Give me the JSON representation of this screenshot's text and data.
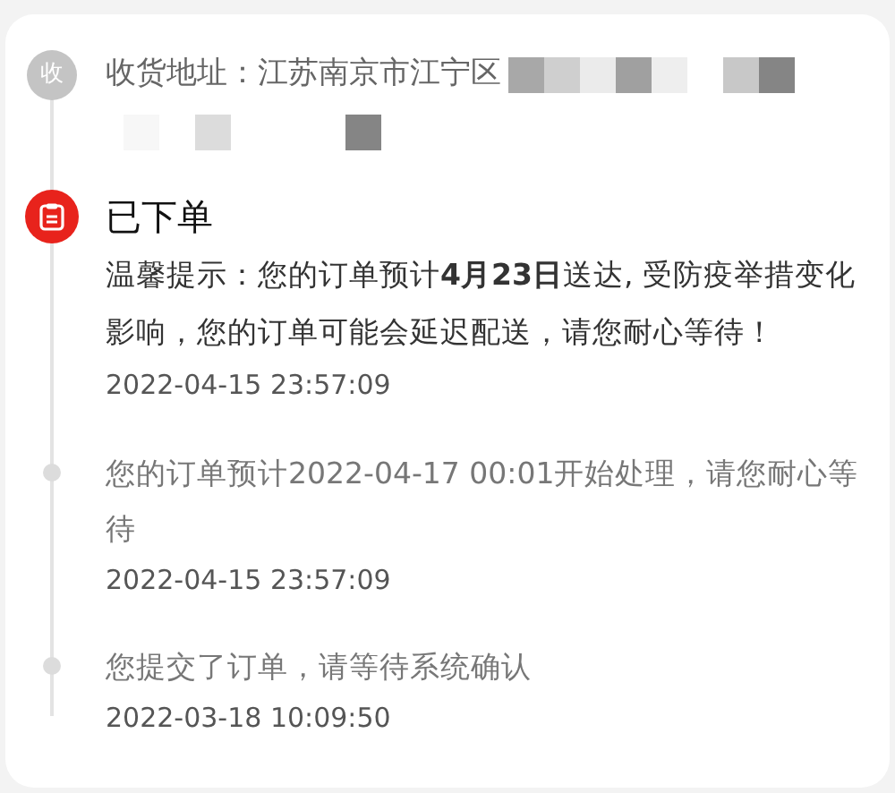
{
  "address": {
    "icon": "收",
    "text": "收货地址：江苏南京市江宁区"
  },
  "events": [
    {
      "kind": "milestone",
      "title": "已下单",
      "message": "温馨提示：您的订单预计**4月23日**送达, 受防疫举措变化影响，您的订单可能会延迟配送，请您耐心等待！",
      "time": "2022-04-15 23:57:09"
    },
    {
      "kind": "step",
      "message": "您的订单预计2022-04-17 00:01开始处理，请您耐心等待",
      "time": "2022-04-15 23:57:09"
    },
    {
      "kind": "step",
      "message": "您提交了订单，请等待系统确认",
      "time": "2022-03-18 10:09:50"
    }
  ]
}
